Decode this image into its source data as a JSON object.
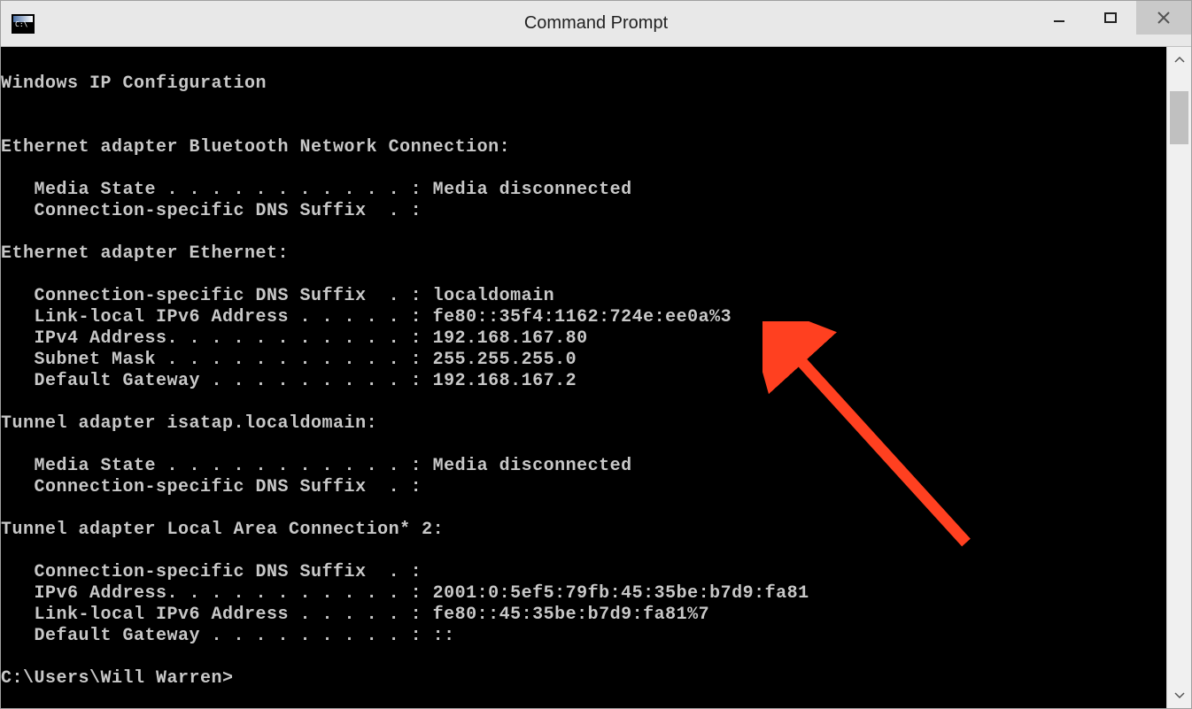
{
  "window": {
    "title": "Command Prompt"
  },
  "terminal": {
    "header": "Windows IP Configuration",
    "sections": [
      {
        "title": "Ethernet adapter Bluetooth Network Connection:",
        "lines": [
          "   Media State . . . . . . . . . . . : Media disconnected",
          "   Connection-specific DNS Suffix  . :"
        ]
      },
      {
        "title": "Ethernet adapter Ethernet:",
        "lines": [
          "   Connection-specific DNS Suffix  . : localdomain",
          "   Link-local IPv6 Address . . . . . : fe80::35f4:1162:724e:ee0a%3",
          "   IPv4 Address. . . . . . . . . . . : 192.168.167.80",
          "   Subnet Mask . . . . . . . . . . . : 255.255.255.0",
          "   Default Gateway . . . . . . . . . : 192.168.167.2"
        ]
      },
      {
        "title": "Tunnel adapter isatap.localdomain:",
        "lines": [
          "   Media State . . . . . . . . . . . : Media disconnected",
          "   Connection-specific DNS Suffix  . :"
        ]
      },
      {
        "title": "Tunnel adapter Local Area Connection* 2:",
        "lines": [
          "   Connection-specific DNS Suffix  . :",
          "   IPv6 Address. . . . . . . . . . . : 2001:0:5ef5:79fb:45:35be:b7d9:fa81",
          "   Link-local IPv6 Address . . . . . : fe80::45:35be:b7d9:fa81%7",
          "   Default Gateway . . . . . . . . . : ::"
        ]
      }
    ],
    "prompt": "C:\\Users\\Will Warren>"
  },
  "annotation": {
    "color": "#ff4020"
  }
}
